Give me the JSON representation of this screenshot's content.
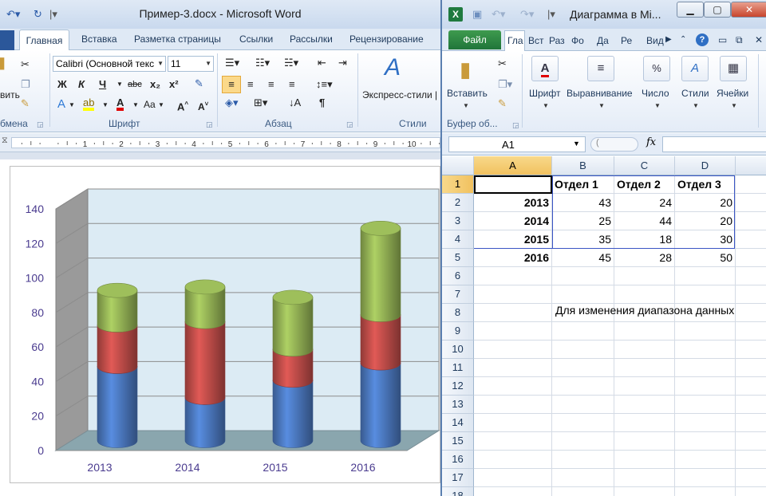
{
  "word": {
    "title": "Пример-3.docx - Microsoft Word",
    "tabs": [
      "Главная",
      "Вставка",
      "Разметка страницы",
      "Ссылки",
      "Рассылки",
      "Рецензирование"
    ],
    "ribbon": {
      "font_name": "Calibri (Основной текс",
      "font_size": "11",
      "groups": [
        "бмена",
        "Шрифт",
        "Абзац",
        "Стили"
      ],
      "clip_label": "вить",
      "styles_label": "Экспресс-стили"
    }
  },
  "excel": {
    "title": "Диаграмма в Mi...",
    "tabs": [
      "Файл",
      "Гла",
      "Вст",
      "Раз",
      "Фо",
      "Да",
      "Ре",
      "Вид"
    ],
    "ribbon": {
      "buttons": [
        "Вставить",
        "Шрифт",
        "Выравнивание",
        "Число",
        "Стили",
        "Ячейки"
      ],
      "group_label": "Буфер об..."
    },
    "name_box": "A1",
    "fx_label": "fx",
    "columns": [
      "A",
      "B",
      "C",
      "D"
    ],
    "rows": [
      "1",
      "2",
      "3",
      "4",
      "5",
      "6",
      "7",
      "8",
      "9",
      "10",
      "11",
      "12",
      "13",
      "14",
      "15",
      "16",
      "17",
      "18"
    ],
    "header_row": [
      "",
      "Отдел 1",
      "Отдел 2",
      "Отдел 3"
    ],
    "data_rows": [
      [
        "2013",
        "43",
        "24",
        "20"
      ],
      [
        "2014",
        "25",
        "44",
        "20"
      ],
      [
        "2015",
        "35",
        "18",
        "30"
      ],
      [
        "2016",
        "45",
        "28",
        "50"
      ]
    ],
    "note": "Для изменения диапазона данных"
  },
  "chart_data": {
    "type": "bar",
    "stacked": true,
    "style": "3d-cylinder",
    "categories": [
      "2013",
      "2014",
      "2015",
      "2016"
    ],
    "series": [
      {
        "values": [
          43,
          25,
          35,
          45
        ],
        "color": "#4f7ec8"
      },
      {
        "values": [
          24,
          44,
          18,
          28
        ],
        "color": "#c9504d"
      },
      {
        "values": [
          20,
          20,
          30,
          50
        ],
        "color": "#9bbb59"
      }
    ],
    "ylim": [
      0,
      140
    ],
    "yticks": [
      0,
      20,
      40,
      60,
      80,
      100,
      120,
      140
    ],
    "grid": true,
    "legend": "none"
  }
}
